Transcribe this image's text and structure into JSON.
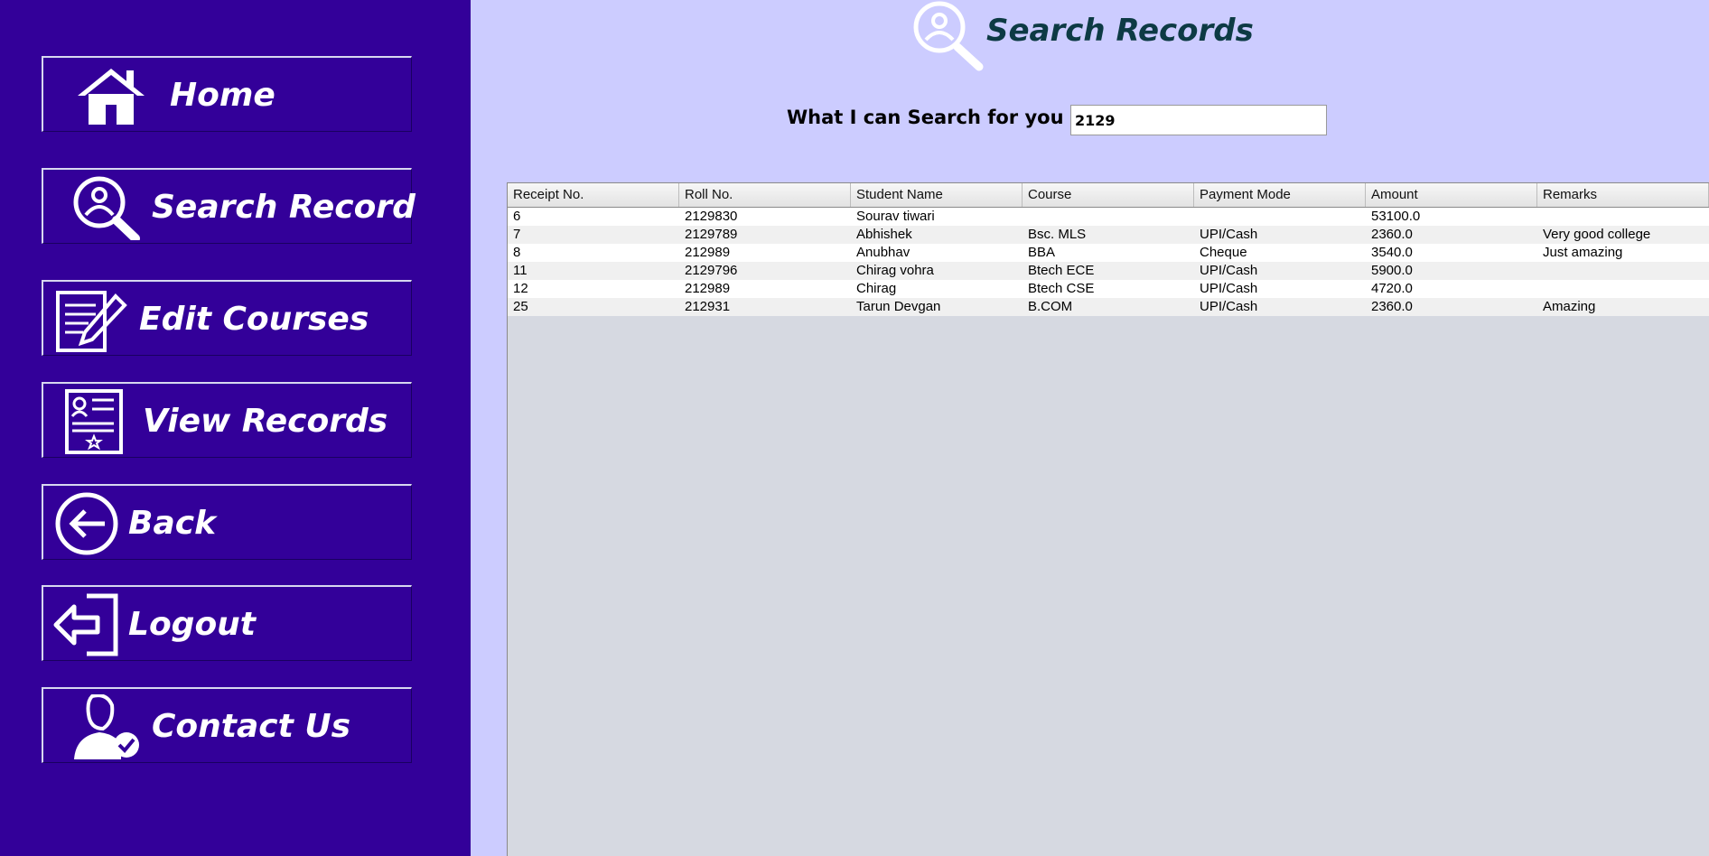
{
  "sidebar": {
    "items": [
      {
        "label": "Home",
        "icon": "home-icon"
      },
      {
        "label": "Search Record",
        "icon": "search-user-icon"
      },
      {
        "label": "Edit Courses",
        "icon": "edit-document-icon"
      },
      {
        "label": "View Records",
        "icon": "id-card-icon"
      },
      {
        "label": "Back",
        "icon": "arrow-left-circle-icon"
      },
      {
        "label": "Logout",
        "icon": "logout-icon"
      },
      {
        "label": "Contact Us",
        "icon": "user-check-icon"
      }
    ]
  },
  "header": {
    "title": "Search Records",
    "icon": "search-user-icon"
  },
  "search": {
    "label": "What I can Search for you :",
    "value": "2129"
  },
  "table": {
    "columns": [
      "Receipt No.",
      "Roll No.",
      "Student Name",
      "Course",
      "Payment Mode",
      "Amount",
      "Remarks"
    ],
    "rows": [
      [
        "6",
        "2129830",
        "Sourav tiwari",
        "",
        "",
        "53100.0",
        ""
      ],
      [
        "7",
        "2129789",
        "Abhishek",
        "Bsc. MLS",
        "UPI/Cash",
        "2360.0",
        "Very good college"
      ],
      [
        "8",
        "212989",
        "Anubhav",
        "BBA",
        "Cheque",
        "3540.0",
        "Just amazing"
      ],
      [
        "11",
        "2129796",
        "Chirag vohra",
        "Btech ECE",
        "UPI/Cash",
        "5900.0",
        ""
      ],
      [
        "12",
        "212989",
        "Chirag",
        "Btech  CSE",
        "UPI/Cash",
        "4720.0",
        ""
      ],
      [
        "25",
        "212931",
        "Tarun Devgan",
        "B.COM",
        "UPI/Cash",
        "2360.0",
        "Amazing"
      ]
    ]
  },
  "colors": {
    "sidebar": "#330099",
    "background": "#ccccff",
    "title": "#0d3a44"
  }
}
